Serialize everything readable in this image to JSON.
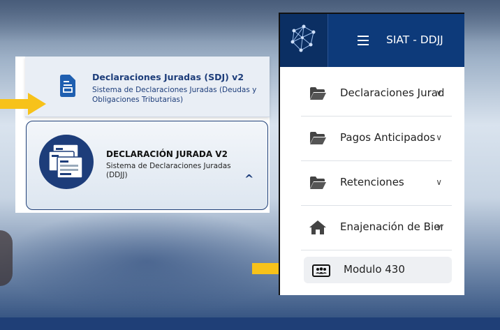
{
  "left_panel": {
    "card1": {
      "title": "Declaraciones Juradas (SDJ) v2",
      "subtitle": "Sistema de Declaraciones Juradas (Deudas y Obligaciones Tributarias)",
      "icon": "document-icon"
    },
    "card2": {
      "title": "DECLARACIÓN JURADA V2",
      "subtitle": "Sistema de Declaraciones Juradas (DDJJ)",
      "icon": "forms-stack-icon",
      "chevron": "^"
    }
  },
  "sidebar": {
    "header": {
      "title": "SIAT - DDJJ",
      "menu_icon": "hamburger-icon",
      "logo_icon": "network-logo-icon"
    },
    "items": [
      {
        "label": "Declaraciones Juradas",
        "icon": "folder-open-icon",
        "chevron": "∨"
      },
      {
        "label": "Pagos Anticipados",
        "icon": "folder-open-icon",
        "chevron": "∨"
      },
      {
        "label": "Retenciones",
        "icon": "folder-open-icon",
        "chevron": "∨"
      },
      {
        "label": "Enajenación de Bienes",
        "icon": "home-icon",
        "chevron": "∨"
      }
    ],
    "active_item": {
      "label": "Modulo 430",
      "icon": "id-card-users-icon"
    }
  },
  "colors": {
    "navy": "#0d3a7a",
    "arrow_yellow": "#f7c21a",
    "card_text": "#1d3d7a"
  }
}
